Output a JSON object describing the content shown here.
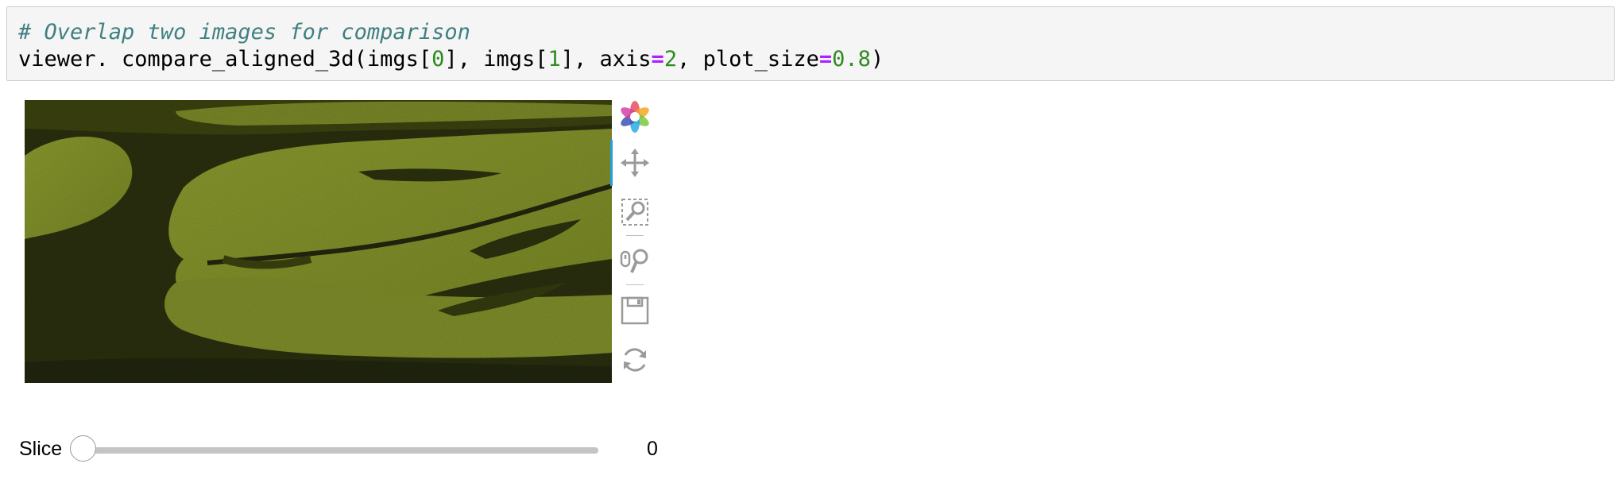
{
  "code_cell": {
    "comment": "# Overlap two images for comparison",
    "line2": {
      "prefix": "viewer. compare_aligned_3d(imgs[",
      "idx0": "0",
      "mid1": "], imgs[",
      "idx1": "1",
      "mid2": "], axis",
      "eq1": "=",
      "axis_val": "2",
      "mid3": ", plot_size",
      "eq2": "=",
      "size_val": "0.8",
      "suffix": ")"
    }
  },
  "figure": {
    "image_tint": "#8a9a2a",
    "toolbar": [
      {
        "icon": "bokeh-logo-icon",
        "interactable": false
      },
      {
        "icon": "pan-move-icon",
        "active": true
      },
      {
        "icon": "box-zoom-icon"
      },
      {
        "icon": "wheel-zoom-icon"
      },
      {
        "icon": "save-icon"
      },
      {
        "icon": "reset-icon"
      }
    ]
  },
  "slider": {
    "label": "Slice",
    "value": "0",
    "fraction": 0
  },
  "colors": {
    "comment": "#408080",
    "number": "#2e8b1f",
    "operator": "#aa22ff",
    "active_tool": "#26a0da"
  }
}
